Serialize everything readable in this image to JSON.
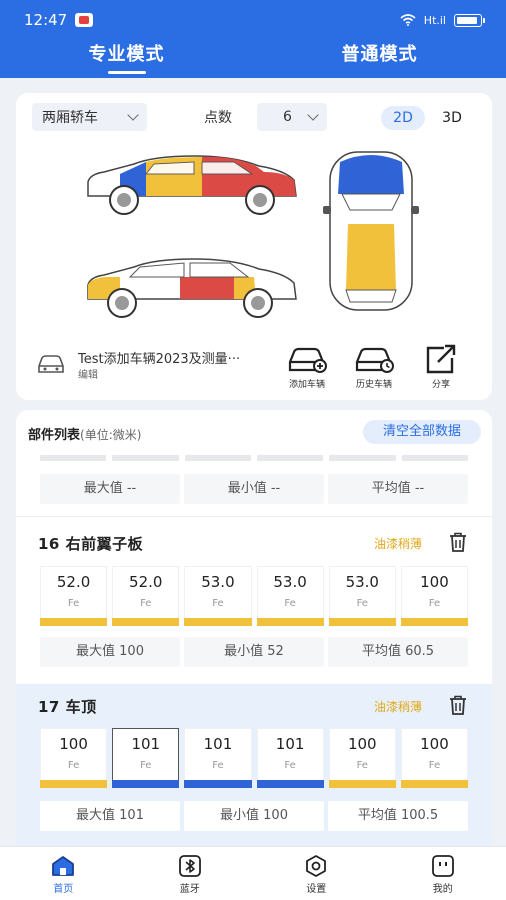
{
  "status": {
    "time": "12:47",
    "signal_text": "Ht.il"
  },
  "header": {
    "tabs": [
      {
        "label": "专业模式",
        "active": true
      },
      {
        "label": "普通模式",
        "active": false
      }
    ]
  },
  "controls": {
    "car_type": "两厢轿车",
    "points_label": "点数",
    "points_value": "6",
    "view_2d": "2D",
    "view_3d": "3D"
  },
  "vehicle": {
    "name": "Test添加车辆2023及测量···",
    "edit_label": "编辑"
  },
  "actions": [
    {
      "label": "添加车辆",
      "icon": "car-add-icon"
    },
    {
      "label": "历史车辆",
      "icon": "car-history-icon"
    },
    {
      "label": "分享",
      "icon": "share-icon"
    }
  ],
  "colors": {
    "primary": "#2b6de3",
    "yellow": "#f2c13c",
    "red": "#dc4a45",
    "blue": "#2f63d6",
    "accent_orange": "#e3a81c"
  },
  "parts_list": {
    "title": "部件列表",
    "unit": "(单位:微米)",
    "clear_label": "清空全部数据",
    "summary_prev": {
      "max": "最大值 --",
      "min": "最小值 --",
      "avg": "平均值 --"
    },
    "parts": [
      {
        "title": "16 右前翼子板",
        "tag": "油漆稍薄",
        "readings": [
          {
            "value": "52.0",
            "material": "Fe",
            "bar": "yellow"
          },
          {
            "value": "52.0",
            "material": "Fe",
            "bar": "yellow"
          },
          {
            "value": "53.0",
            "material": "Fe",
            "bar": "yellow"
          },
          {
            "value": "53.0",
            "material": "Fe",
            "bar": "yellow"
          },
          {
            "value": "53.0",
            "material": "Fe",
            "bar": "yellow"
          },
          {
            "value": "100",
            "material": "Fe",
            "bar": "yellow"
          }
        ],
        "max": "最大值 100",
        "min": "最小值 52",
        "avg": "平均值 60.5"
      },
      {
        "title": "17 车顶",
        "tag": "油漆稍薄",
        "readings": [
          {
            "value": "100",
            "material": "Fe",
            "bar": "yellow"
          },
          {
            "value": "101",
            "material": "Fe",
            "bar": "blue",
            "selected": true
          },
          {
            "value": "101",
            "material": "Fe",
            "bar": "blue"
          },
          {
            "value": "101",
            "material": "Fe",
            "bar": "blue"
          },
          {
            "value": "100",
            "material": "Fe",
            "bar": "yellow"
          },
          {
            "value": "100",
            "material": "Fe",
            "bar": "yellow"
          }
        ],
        "max": "最大值 101",
        "min": "最小值 100",
        "avg": "平均值 100.5"
      }
    ]
  },
  "bottom_nav": [
    {
      "label": "首页",
      "icon": "home-icon",
      "active": true
    },
    {
      "label": "蓝牙",
      "icon": "bluetooth-icon",
      "active": false
    },
    {
      "label": "设置",
      "icon": "settings-icon",
      "active": false
    },
    {
      "label": "我的",
      "icon": "profile-icon",
      "active": false
    }
  ]
}
